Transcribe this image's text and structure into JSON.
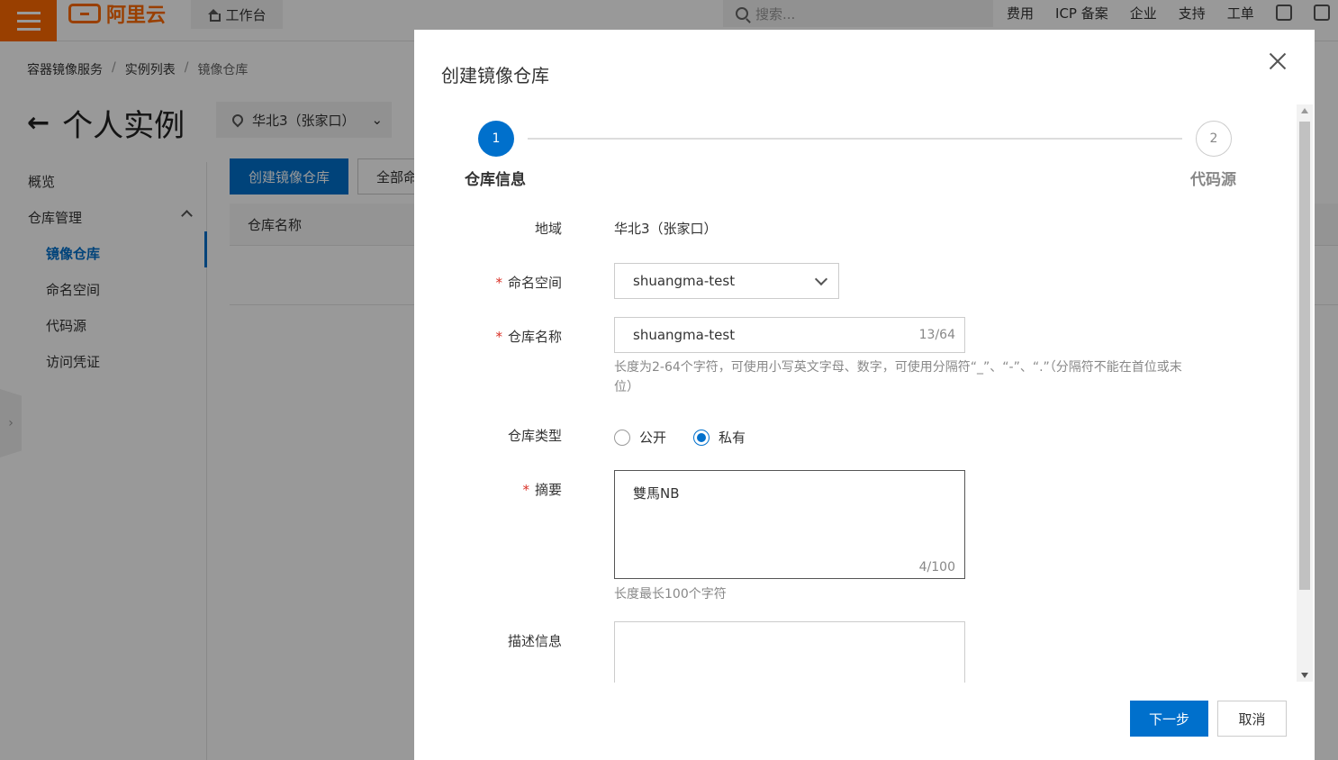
{
  "topbar": {
    "logo_text": "阿里云",
    "workbench_label": "工作台",
    "search_placeholder": "搜索...",
    "nav": [
      "费用",
      "ICP 备案",
      "企业",
      "支持",
      "工单"
    ]
  },
  "breadcrumb": [
    "容器镜像服务",
    "实例列表",
    "镜像仓库"
  ],
  "page": {
    "title": "个人实例",
    "region": "华北3（张家口）"
  },
  "sidebar": {
    "overview": "概览",
    "repo_mgmt": "仓库管理",
    "items": [
      "镜像仓库",
      "命名空间",
      "代码源",
      "访问凭证"
    ]
  },
  "toolbar": {
    "create_label": "创建镜像仓库",
    "all_label": "全部命名空间"
  },
  "table": {
    "col_name": "仓库名称"
  },
  "dialog": {
    "title": "创建镜像仓库",
    "steps": [
      {
        "number": "1",
        "label": "仓库信息"
      },
      {
        "number": "2",
        "label": "代码源"
      }
    ],
    "fields": {
      "region_label": "地域",
      "region_value": "华北3（张家口）",
      "namespace_label": "命名空间",
      "namespace_value": "shuangma-test",
      "repo_name_label": "仓库名称",
      "repo_name_value": "shuangma-test",
      "repo_name_counter": "13/64",
      "repo_name_hint": "长度为2-64个字符，可使用小写英文字母、数字，可使用分隔符“_”、“-”、“.”（分隔符不能在首位或末位）",
      "repo_type_label": "仓库类型",
      "repo_type_public": "公开",
      "repo_type_private": "私有",
      "summary_label": "摘要",
      "summary_value": "雙馬NB",
      "summary_counter": "4/100",
      "summary_hint": "长度最长100个字符",
      "description_label": "描述信息"
    },
    "buttons": {
      "next": "下一步",
      "cancel": "取消"
    }
  },
  "colors": {
    "brand": "#ff6a00",
    "primary": "#0070cc",
    "required": "#d93026"
  }
}
